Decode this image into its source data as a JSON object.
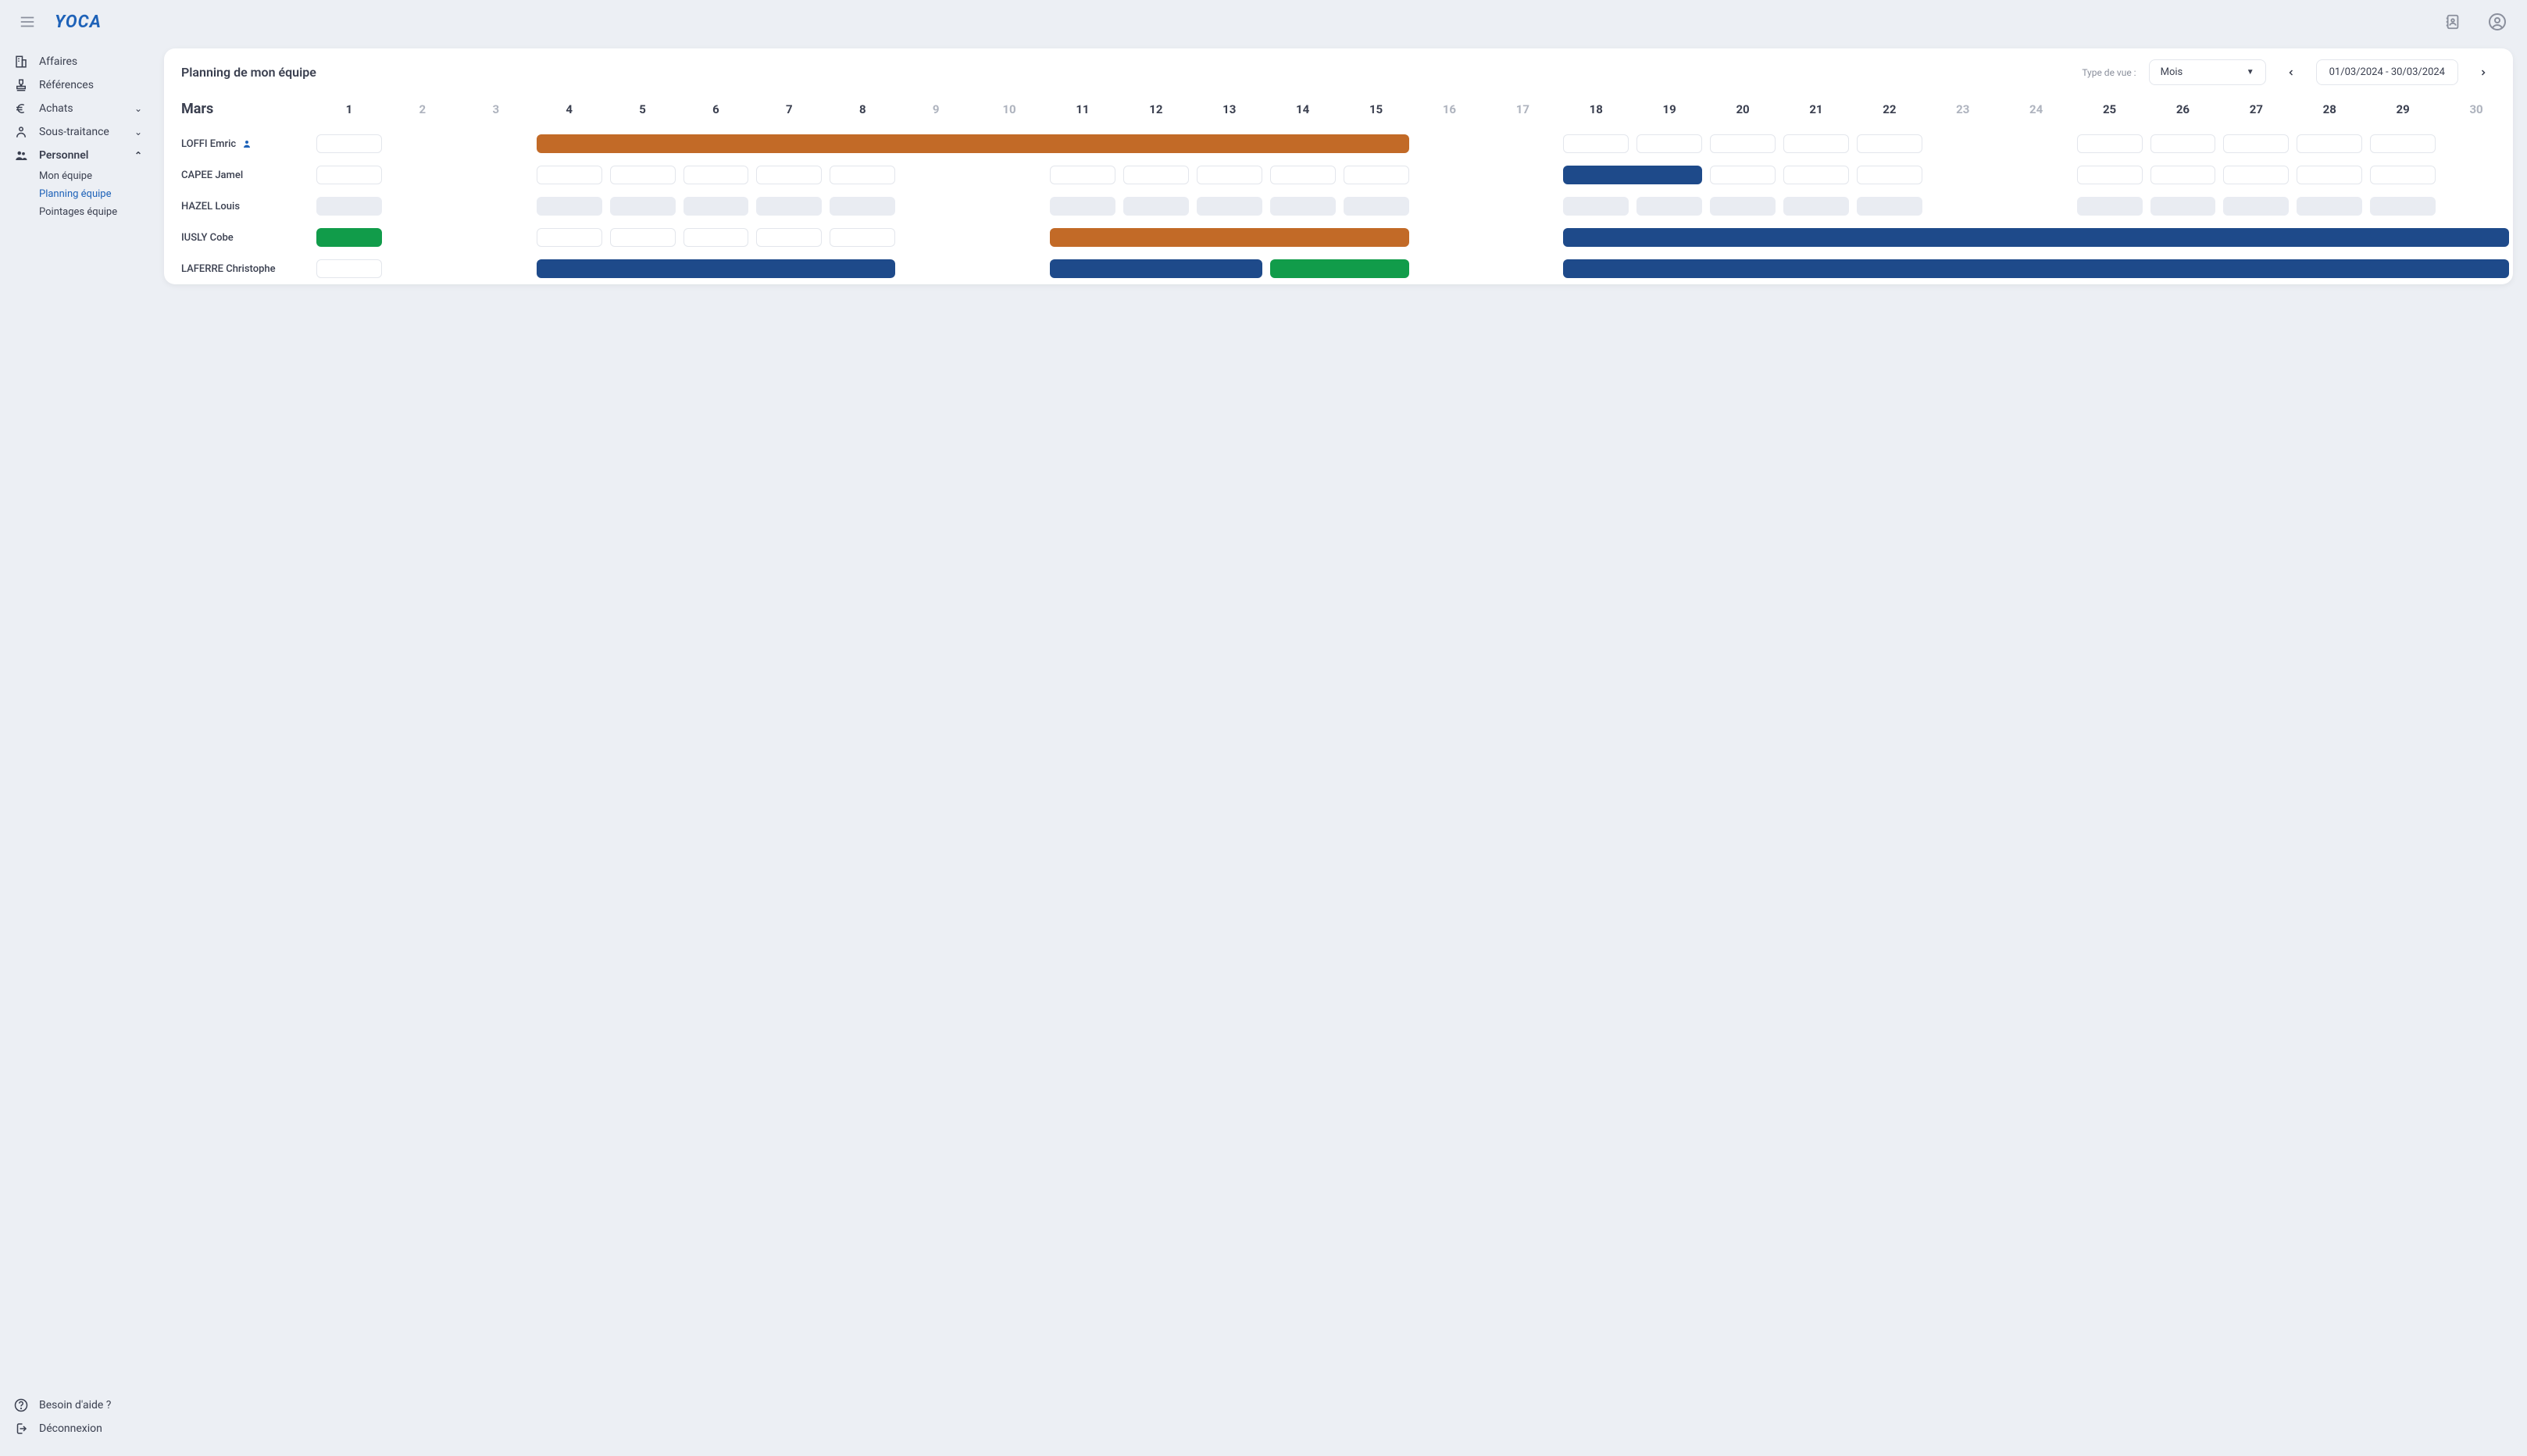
{
  "logo": "YOCA",
  "sidebar": {
    "affaires": "Affaires",
    "references": "Références",
    "achats": "Achats",
    "soustraitance": "Sous-traitance",
    "personnel": "Personnel",
    "mon_equipe": "Mon équipe",
    "planning_equipe": "Planning équipe",
    "pointages_equipe": "Pointages équipe",
    "aide": "Besoin d'aide ?",
    "deconnexion": "Déconnexion"
  },
  "panel": {
    "title": "Planning de mon équipe",
    "view_label": "Type de vue :",
    "view_value": "Mois",
    "date_range": "01/03/2024 - 30/03/2024"
  },
  "month": "Mars",
  "days": [
    {
      "n": "1",
      "we": false
    },
    {
      "n": "2",
      "we": true
    },
    {
      "n": "3",
      "we": true
    },
    {
      "n": "4",
      "we": false
    },
    {
      "n": "5",
      "we": false
    },
    {
      "n": "6",
      "we": false
    },
    {
      "n": "7",
      "we": false
    },
    {
      "n": "8",
      "we": false
    },
    {
      "n": "9",
      "we": true
    },
    {
      "n": "10",
      "we": true
    },
    {
      "n": "11",
      "we": false
    },
    {
      "n": "12",
      "we": false
    },
    {
      "n": "13",
      "we": false
    },
    {
      "n": "14",
      "we": false
    },
    {
      "n": "15",
      "we": false
    },
    {
      "n": "16",
      "we": true
    },
    {
      "n": "17",
      "we": true
    },
    {
      "n": "18",
      "we": false
    },
    {
      "n": "19",
      "we": false
    },
    {
      "n": "20",
      "we": false
    },
    {
      "n": "21",
      "we": false
    },
    {
      "n": "22",
      "we": false
    },
    {
      "n": "23",
      "we": true
    },
    {
      "n": "24",
      "we": true
    },
    {
      "n": "25",
      "we": false
    },
    {
      "n": "26",
      "we": false
    },
    {
      "n": "27",
      "we": false
    },
    {
      "n": "28",
      "we": false
    },
    {
      "n": "29",
      "we": false
    },
    {
      "n": "30",
      "we": true
    }
  ],
  "rows": [
    {
      "name": "LOFFI Emric",
      "is_user": true,
      "cells": [
        {
          "t": "slot"
        },
        {
          "t": "gap"
        },
        {
          "t": "gap"
        },
        {
          "t": "bar",
          "color": "orange",
          "span": 12
        },
        {
          "t": "gap"
        },
        {
          "t": "gap"
        },
        {
          "t": "slot"
        },
        {
          "t": "slot"
        },
        {
          "t": "slot"
        },
        {
          "t": "slot"
        },
        {
          "t": "slot"
        },
        {
          "t": "gap"
        },
        {
          "t": "gap"
        },
        {
          "t": "slot"
        },
        {
          "t": "slot"
        },
        {
          "t": "slot"
        },
        {
          "t": "slot"
        },
        {
          "t": "slot"
        },
        {
          "t": "gap"
        }
      ]
    },
    {
      "name": "CAPEE Jamel",
      "cells": [
        {
          "t": "slot"
        },
        {
          "t": "gap"
        },
        {
          "t": "gap"
        },
        {
          "t": "slot"
        },
        {
          "t": "slot"
        },
        {
          "t": "slot"
        },
        {
          "t": "slot"
        },
        {
          "t": "slot"
        },
        {
          "t": "gap"
        },
        {
          "t": "gap"
        },
        {
          "t": "slot"
        },
        {
          "t": "slot"
        },
        {
          "t": "slot"
        },
        {
          "t": "slot"
        },
        {
          "t": "slot"
        },
        {
          "t": "gap"
        },
        {
          "t": "gap"
        },
        {
          "t": "bar",
          "color": "blue",
          "span": 2
        },
        {
          "t": "slot"
        },
        {
          "t": "slot"
        },
        {
          "t": "slot"
        },
        {
          "t": "gap"
        },
        {
          "t": "gap"
        },
        {
          "t": "slot"
        },
        {
          "t": "slot"
        },
        {
          "t": "slot"
        },
        {
          "t": "slot"
        },
        {
          "t": "slot"
        },
        {
          "t": "gap"
        }
      ]
    },
    {
      "name": "HAZEL Louis",
      "cells": [
        {
          "t": "slot",
          "grey": true
        },
        {
          "t": "gap"
        },
        {
          "t": "gap"
        },
        {
          "t": "slot",
          "grey": true
        },
        {
          "t": "slot",
          "grey": true
        },
        {
          "t": "slot",
          "grey": true
        },
        {
          "t": "slot",
          "grey": true
        },
        {
          "t": "slot",
          "grey": true
        },
        {
          "t": "gap"
        },
        {
          "t": "gap"
        },
        {
          "t": "slot",
          "grey": true
        },
        {
          "t": "slot",
          "grey": true
        },
        {
          "t": "slot",
          "grey": true
        },
        {
          "t": "slot",
          "grey": true
        },
        {
          "t": "slot",
          "grey": true
        },
        {
          "t": "gap"
        },
        {
          "t": "gap"
        },
        {
          "t": "slot",
          "grey": true
        },
        {
          "t": "slot",
          "grey": true
        },
        {
          "t": "slot",
          "grey": true
        },
        {
          "t": "slot",
          "grey": true
        },
        {
          "t": "slot",
          "grey": true
        },
        {
          "t": "gap"
        },
        {
          "t": "gap"
        },
        {
          "t": "slot",
          "grey": true
        },
        {
          "t": "slot",
          "grey": true
        },
        {
          "t": "slot",
          "grey": true
        },
        {
          "t": "slot",
          "grey": true
        },
        {
          "t": "slot",
          "grey": true
        },
        {
          "t": "gap"
        }
      ]
    },
    {
      "name": "IUSLY Cobe",
      "cells": [
        {
          "t": "bar",
          "color": "green",
          "span": 1
        },
        {
          "t": "gap"
        },
        {
          "t": "gap"
        },
        {
          "t": "slot"
        },
        {
          "t": "slot"
        },
        {
          "t": "slot"
        },
        {
          "t": "slot"
        },
        {
          "t": "slot"
        },
        {
          "t": "gap"
        },
        {
          "t": "gap"
        },
        {
          "t": "bar",
          "color": "orange",
          "span": 5
        },
        {
          "t": "gap"
        },
        {
          "t": "gap"
        },
        {
          "t": "bar",
          "color": "blue",
          "span": 13
        }
      ]
    },
    {
      "name": "LAFERRE Christophe",
      "cells": [
        {
          "t": "slot"
        },
        {
          "t": "gap"
        },
        {
          "t": "gap"
        },
        {
          "t": "bar",
          "color": "blue",
          "span": 5
        },
        {
          "t": "gap"
        },
        {
          "t": "gap"
        },
        {
          "t": "bar",
          "color": "blue",
          "span": 3
        },
        {
          "t": "bar",
          "color": "green",
          "span": 2
        },
        {
          "t": "gap"
        },
        {
          "t": "gap"
        },
        {
          "t": "bar",
          "color": "blue",
          "span": 13
        }
      ]
    }
  ]
}
